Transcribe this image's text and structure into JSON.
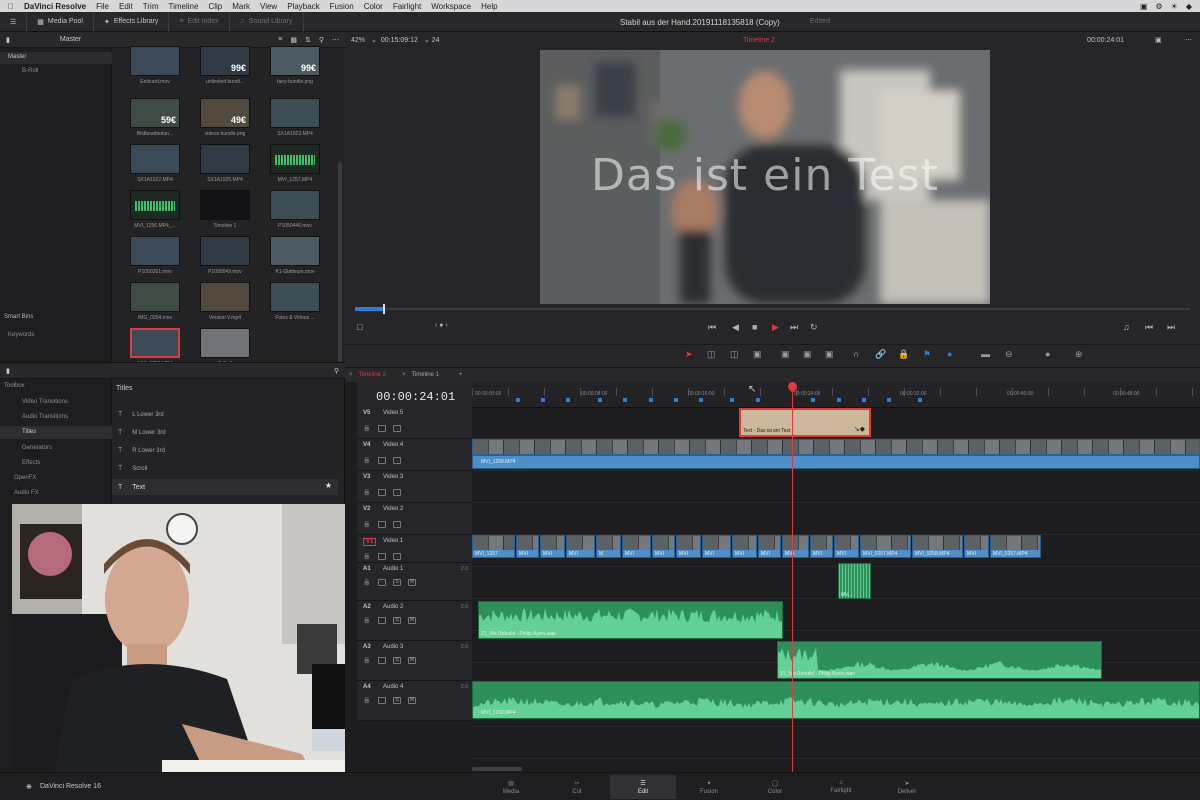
{
  "menubar": {
    "app_name": "DaVinci Resolve",
    "items": [
      "File",
      "Edit",
      "Trim",
      "Timeline",
      "Clip",
      "Mark",
      "View",
      "Playback",
      "Fusion",
      "Color",
      "Fairlight",
      "Workspace",
      "Help"
    ]
  },
  "toolbar": {
    "media_pool": "Media Pool",
    "effects_library": "Effects Library",
    "edit_index": "Edit Index",
    "sound_library": "Sound Library",
    "project_title": "Stabil aus der Hand.20191118135818 (Copy)",
    "project_status": "Edited"
  },
  "media_pool": {
    "bin_title": "Master",
    "tree_master": "Master",
    "tree_broll": "B-Roll",
    "smart_bins": "Smart Bins",
    "keywords": "Keywords",
    "clips": [
      {
        "label": "Endcard.mov",
        "badge": ""
      },
      {
        "label": "unlimited bundl...",
        "badge": "99€"
      },
      {
        "label": "fairy-bundle.png",
        "badge": "99€"
      },
      {
        "label": "Bildbearbeitun...",
        "badge": "59€"
      },
      {
        "label": "videos bundle.png",
        "badge": "49€"
      },
      {
        "label": "SX1A1923.MP4",
        "badge": ""
      },
      {
        "label": "SX1A1922.MP4",
        "badge": ""
      },
      {
        "label": "SX1A1925.MP4",
        "badge": ""
      },
      {
        "label": "MVI_1257.MP4",
        "badge": ""
      },
      {
        "label": "MVI_1256.MP4_...",
        "badge": ""
      },
      {
        "label": "Timeline 1",
        "badge": ""
      },
      {
        "label": "P1050446.mov",
        "badge": ""
      },
      {
        "label": "P1050261.mov",
        "badge": ""
      },
      {
        "label": "P1050049.mov",
        "badge": ""
      },
      {
        "label": "K1-Glatteum.mov",
        "badge": ""
      },
      {
        "label": "IMG_0354.mov",
        "badge": ""
      },
      {
        "label": "Version V.mp4",
        "badge": ""
      },
      {
        "label": "Fotos & Videos ...",
        "badge": ""
      },
      {
        "label": "MVI_1259.MP4",
        "badge": ""
      },
      {
        "label": "B-Roll",
        "badge": ""
      }
    ]
  },
  "viewer": {
    "zoom": "42%",
    "source_timecode": "00:15:09:12",
    "fps": "24",
    "timeline_name": "Timeline 2",
    "record_timecode": "00:00:24:01",
    "overlay_text": "Das ist ein Test"
  },
  "effects": {
    "toolbox": "Toolbox",
    "video_transitions": "Video Transitions",
    "audio_transitions": "Audio Transitions",
    "titles": "Titles",
    "generators": "Generators",
    "effects": "Effects",
    "openfx": "OpenFX",
    "audio_fx": "Audio FX",
    "panel_title": "Titles",
    "title_items": [
      "L Lower 3rd",
      "M Lower 3rd",
      "R Lower 3rd",
      "Scroll",
      "Text"
    ]
  },
  "timeline": {
    "tab_active": "Timeline 2",
    "tab_other": "Timeline 1",
    "timecode": "00:00:24:01",
    "ruler": [
      "00:00:00:00",
      "00:00:08:00",
      "00:00:16:00",
      "00:00:24:00",
      "00:00:32:00",
      "00:00:40:00",
      "00:00:48:00"
    ],
    "tracks": [
      {
        "id": "V5",
        "name": "Video 5",
        "vol": ""
      },
      {
        "id": "V4",
        "name": "Video 4",
        "vol": ""
      },
      {
        "id": "V3",
        "name": "Video 3",
        "vol": ""
      },
      {
        "id": "V2",
        "name": "Video 2",
        "vol": ""
      },
      {
        "id": "V1",
        "name": "Video 1",
        "vol": ""
      },
      {
        "id": "A1",
        "name": "Audio 1",
        "vol": "2.0"
      },
      {
        "id": "A2",
        "name": "Audio 2",
        "vol": "2.0"
      },
      {
        "id": "A3",
        "name": "Audio 3",
        "vol": "2.0"
      },
      {
        "id": "A4",
        "name": "Audio 4",
        "vol": "2.0"
      }
    ],
    "clips": {
      "text": "Text - Das ist ein Test",
      "v4": "MVI_1259.MP4",
      "a1": "MV...",
      "a2": "21_We Rebuild - Philip Ayers.wav",
      "a3": "21_We Rebuild - Philip Ayers.wav",
      "a4": "MVI_1259.MP4",
      "v1_labels": [
        "MVI_1257",
        "MVI",
        "MVI",
        "MVI",
        "M",
        "MVI",
        "MVI",
        "MVI",
        "MVI",
        "MVI",
        "MVI",
        "MVI",
        "MVI",
        "MVI",
        "MVI_0257.MP4",
        "MVI_0258.MP4",
        "MVI",
        "MVI_0257.MP4"
      ]
    }
  },
  "pages": [
    "Media",
    "Cut",
    "Edit",
    "Fusion",
    "Color",
    "Fairlight",
    "Deliver"
  ],
  "active_page": "Edit",
  "footer": {
    "app_version": "DaVinci Resolve 16"
  },
  "colors": {
    "accent_red": "#e0393e",
    "clip_blue": "#4e8fc9",
    "clip_green": "#2f8f5b",
    "title_clip": "#cdb89c"
  }
}
